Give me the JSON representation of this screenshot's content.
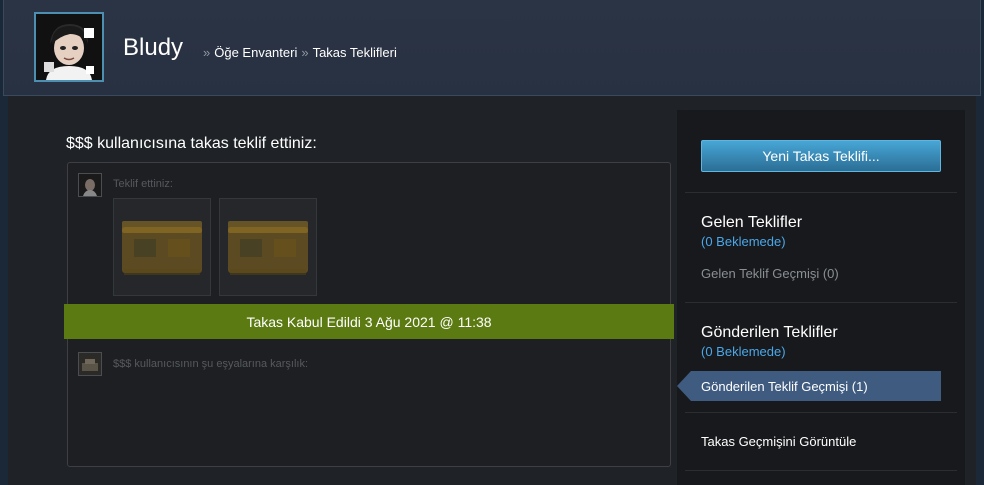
{
  "header": {
    "user_name": "Bludy",
    "breadcrumb": [
      {
        "label": "Öğe Envanteri"
      },
      {
        "label": "Takas Teklifleri"
      }
    ],
    "breadcrumb_separator": "»"
  },
  "offer": {
    "heading": "$$$ kullanıcısına takas teklif ettiniz:",
    "you_offered_label": "Teklif ettiniz:",
    "items_offered": [
      {
        "icon": "weapon-case-icon"
      },
      {
        "icon": "weapon-case-icon"
      }
    ],
    "status_text": "Takas Kabul Edildi 3 Ağu 2021 @ 11:38",
    "in_exchange_label": "$$$ kullanıcısının şu eşyalarına karşılık:"
  },
  "sidebar": {
    "new_offer_button": "Yeni Takas Teklifi...",
    "incoming": {
      "title": "Gelen Teklifler",
      "pending": "(0 Beklemede)",
      "history_link": "Gelen Teklif Geçmişi (0)"
    },
    "sent": {
      "title": "Gönderilen Teklifler",
      "pending": "(0 Beklemede)",
      "history_link": "Gönderilen Teklif Geçmişi (1)"
    },
    "trade_history_link": "Takas Geçmişini Görüntüle"
  },
  "colors": {
    "accepted_bar": "#5b7a11",
    "button_blue": "#47a6d6",
    "pending_blue": "#4aa7ea",
    "active_tab": "#3f5b80"
  }
}
